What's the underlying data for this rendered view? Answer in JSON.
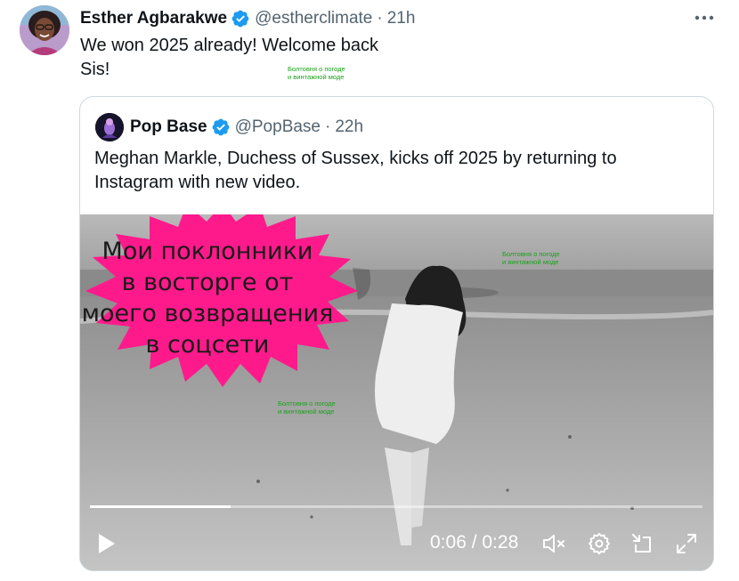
{
  "tweet": {
    "author_name": "Esther Agbarakwe",
    "handle": "@estherclimate",
    "separator": "·",
    "time": "21h",
    "text_line1": "We won 2025 already! Welcome back",
    "text_line2": "Sis!",
    "icons": {
      "verified": "verified-badge-icon",
      "more": "more-icon"
    }
  },
  "quote": {
    "author_name": "Pop Base",
    "handle": "@PopBase",
    "separator": "·",
    "time": "22h",
    "text_line1": "Meghan Markle, Duchess of Sussex, kicks off 2025 by returning to",
    "text_line2": "Instagram with new video."
  },
  "video": {
    "caption_line1": "Мои поклонники",
    "caption_line2": "в восторге от",
    "caption_line3": "моего возвращения",
    "caption_line4": "в соцсети",
    "time_readout": "0:06 / 0:28",
    "progress": 0.23,
    "controls": [
      "play-icon",
      "mute-icon",
      "settings-icon",
      "exit-icon",
      "fullscreen-icon"
    ]
  },
  "watermark": {
    "line1": "Болтовня о погоде",
    "line2": "и винтажной моде"
  },
  "colors": {
    "verified_blue": "#1d9bf0",
    "burst_pink": "#ff1a8c",
    "text_primary": "#0f1419",
    "text_secondary": "#536471",
    "watermark_green": "#1aa11a"
  }
}
